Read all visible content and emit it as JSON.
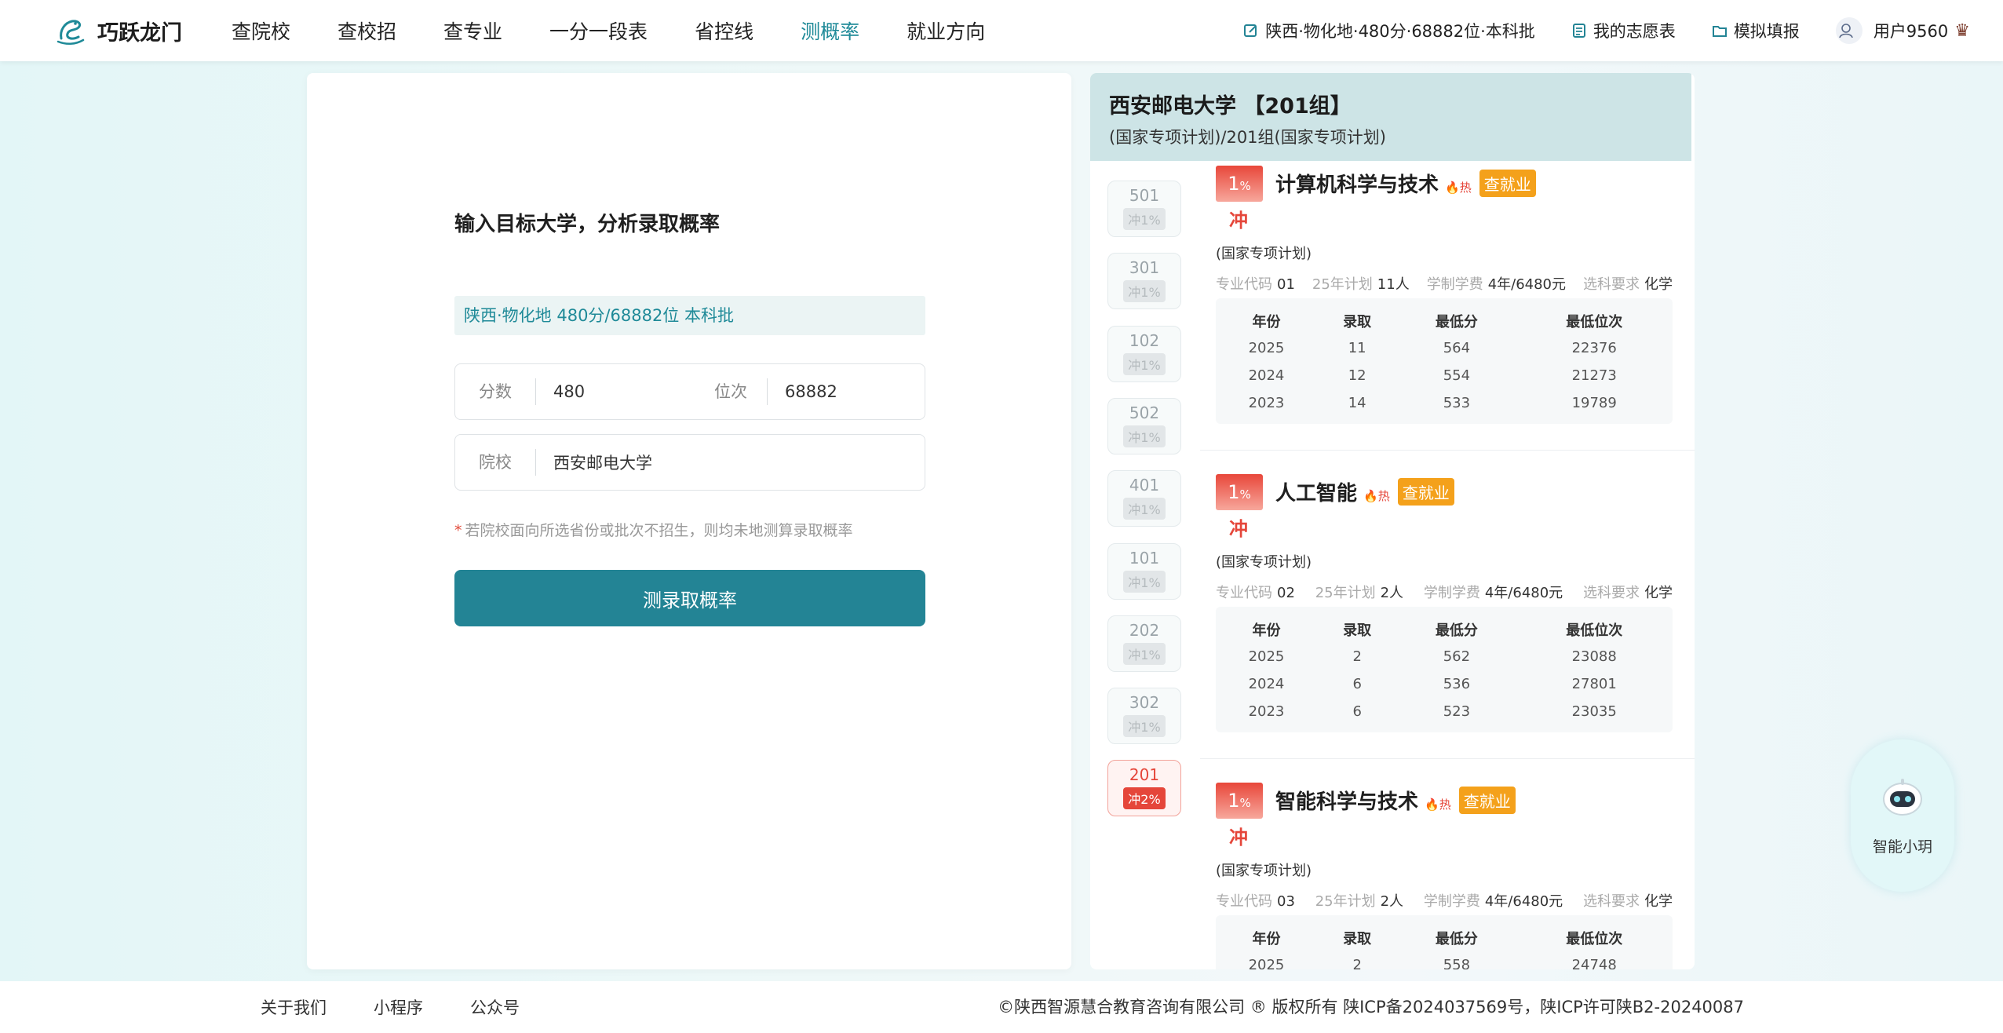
{
  "header": {
    "logo_text": "巧跃龙门",
    "nav": [
      "查院校",
      "查校招",
      "查专业",
      "一分一段表",
      "省控线",
      "测概率",
      "就业方向"
    ],
    "active_nav": "测概率",
    "profile_link": "陕西·物化地·480分·68882位·本科批",
    "wishlist_link": "我的志愿表",
    "simulate_link": "模拟填报",
    "user_name": "用户9560"
  },
  "form": {
    "title": "输入目标大学，分析录取概率",
    "info": "陕西·物化地 480分/68882位 本科批",
    "score_label": "分数",
    "score_value": "480",
    "rank_label": "位次",
    "rank_value": "68882",
    "school_label": "院校",
    "school_value": "西安邮电大学",
    "note_star": "*",
    "note": "若院校面向所选省份或批次不招生，则均未地测算录取概率",
    "submit_label": "测录取概率"
  },
  "result": {
    "title": "西安邮电大学 【201组】",
    "subtitle": "(国家专项计划)/201组(国家专项计划)",
    "groups": [
      {
        "code": "501",
        "pct": "冲1%",
        "active": false
      },
      {
        "code": "301",
        "pct": "冲1%",
        "active": false
      },
      {
        "code": "102",
        "pct": "冲1%",
        "active": false
      },
      {
        "code": "502",
        "pct": "冲1%",
        "active": false
      },
      {
        "code": "401",
        "pct": "冲1%",
        "active": false
      },
      {
        "code": "101",
        "pct": "冲1%",
        "active": false
      },
      {
        "code": "202",
        "pct": "冲1%",
        "active": false
      },
      {
        "code": "302",
        "pct": "冲1%",
        "active": false
      },
      {
        "code": "201",
        "pct": "冲2%",
        "active": true
      }
    ],
    "table_headers": [
      "年份",
      "录取",
      "最低分",
      "最低位次"
    ],
    "meta_labels": {
      "code": "专业代码",
      "plan": "25年计划",
      "fee": "学制学费",
      "req": "选科要求"
    },
    "majors": [
      {
        "pct": "1",
        "pct_unit": "%",
        "tag": "冲",
        "name": "计算机科学与技术",
        "hot": "热",
        "jobs": "查就业",
        "plan_type": "(国家专项计划)",
        "code": "01",
        "plan": "11人",
        "fee": "4年/6480元",
        "req": "化学",
        "rows": [
          [
            "2025",
            "11",
            "564",
            "22376"
          ],
          [
            "2024",
            "12",
            "554",
            "21273"
          ],
          [
            "2023",
            "14",
            "533",
            "19789"
          ]
        ]
      },
      {
        "pct": "1",
        "pct_unit": "%",
        "tag": "冲",
        "name": "人工智能",
        "hot": "热",
        "jobs": "查就业",
        "plan_type": "(国家专项计划)",
        "code": "02",
        "plan": "2人",
        "fee": "4年/6480元",
        "req": "化学",
        "rows": [
          [
            "2025",
            "2",
            "562",
            "23088"
          ],
          [
            "2024",
            "6",
            "536",
            "27801"
          ],
          [
            "2023",
            "6",
            "523",
            "23035"
          ]
        ]
      },
      {
        "pct": "1",
        "pct_unit": "%",
        "tag": "冲",
        "name": "智能科学与技术",
        "hot": "热",
        "jobs": "查就业",
        "plan_type": "(国家专项计划)",
        "code": "03",
        "plan": "2人",
        "fee": "4年/6480元",
        "req": "化学",
        "rows": [
          [
            "2025",
            "2",
            "558",
            "24748"
          ]
        ]
      }
    ]
  },
  "bot": {
    "label": "智能小玥"
  },
  "footer": {
    "links": [
      "关于我们",
      "小程序",
      "公众号"
    ],
    "copyright": "©陕西智源慧合教育咨询有限公司 ® 版权所有 陕ICP备2024037569号，陕ICP许可陕B2-20240087"
  },
  "colors": {
    "accent": "#238495",
    "danger": "#e5463a",
    "warning": "#f4a11b"
  }
}
